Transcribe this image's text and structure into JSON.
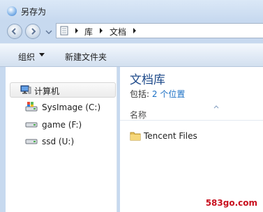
{
  "window": {
    "title": "另存为",
    "accent": "#1e4a8a"
  },
  "address": {
    "crumbs": [
      "库",
      "文档"
    ]
  },
  "toolbar": {
    "organize_label": "组织",
    "new_folder_label": "新建文件夹"
  },
  "navigation": {
    "computer_label": "计算机",
    "drives": [
      {
        "label": "SysImage (C:)",
        "icon": "system-drive-icon"
      },
      {
        "label": "game (F:)",
        "icon": "drive-icon"
      },
      {
        "label": "ssd (U:)",
        "icon": "drive-icon"
      }
    ]
  },
  "library": {
    "title": "文档库",
    "includes_label": "包括:",
    "locations_link": "2 个位置",
    "column_name": "名称",
    "files": [
      {
        "name": "Tencent Files",
        "icon": "folder-icon"
      }
    ]
  },
  "watermark": {
    "text": "583go.com"
  }
}
